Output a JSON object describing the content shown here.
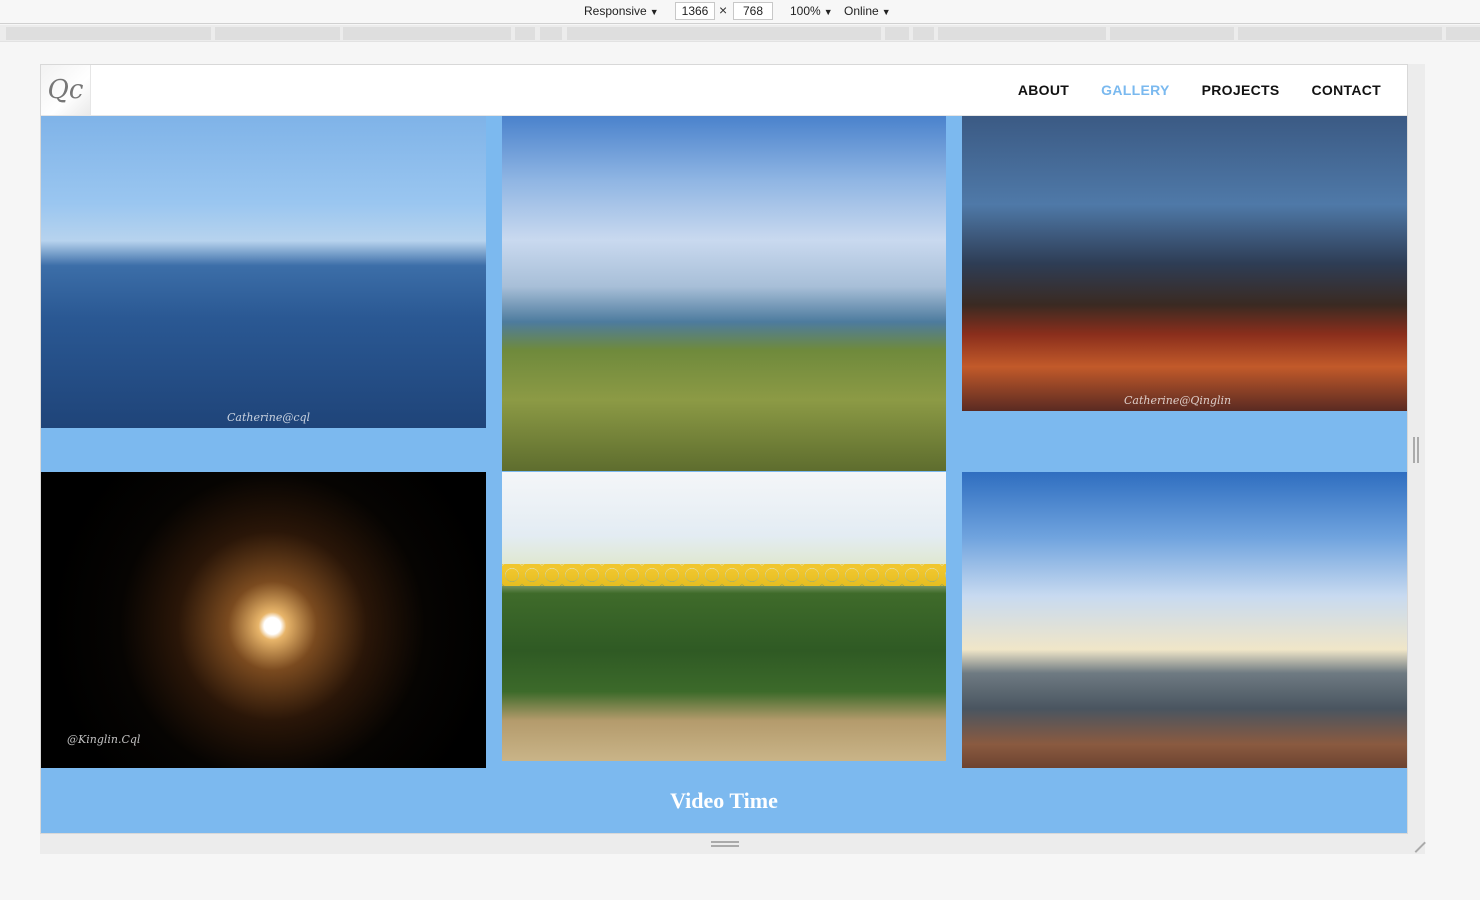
{
  "devtools": {
    "device_mode": "Responsive",
    "width": "1366",
    "height": "768",
    "zoom": "100%",
    "network": "Online"
  },
  "site": {
    "logo_text": "Qc",
    "nav": [
      {
        "label": "ABOUT",
        "active": false
      },
      {
        "label": "GALLERY",
        "active": true
      },
      {
        "label": "PROJECTS",
        "active": false
      },
      {
        "label": "CONTACT",
        "active": false
      }
    ],
    "accent_color": "#7ab9ef",
    "gallery_bg_color": "#7cb9ef"
  },
  "gallery": {
    "photos": [
      {
        "subject": "lake-pier-photo",
        "watermark": "Catherine@cql"
      },
      {
        "subject": "golden-gate-flowers-photo",
        "watermark": ""
      },
      {
        "subject": "brooklyn-bridge-photo",
        "watermark": "Catherine@Qinglin"
      },
      {
        "subject": "full-moon-photo",
        "watermark": "@Kinglin.Cql"
      },
      {
        "subject": "sunflower-field-photo",
        "watermark": ""
      },
      {
        "subject": "mountain-summit-photo",
        "watermark": ""
      }
    ],
    "section_title": "Video Time"
  }
}
